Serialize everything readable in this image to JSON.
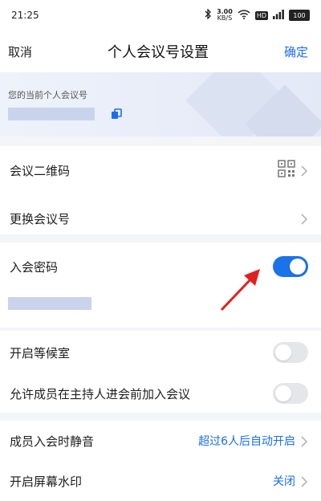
{
  "status_bar": {
    "time": "21:25",
    "speed": "3.00",
    "speed_unit": "KB/S",
    "hd": "HD",
    "battery": "100"
  },
  "nav": {
    "cancel": "取消",
    "title": "个人会议号设置",
    "confirm": "确定"
  },
  "banner": {
    "label": "您的当前个人会议号"
  },
  "rows": {
    "qr": {
      "label": "会议二维码"
    },
    "change_id": {
      "label": "更换会议号"
    },
    "password": {
      "label": "入会密码",
      "enabled": true
    },
    "waiting_room": {
      "label": "开启等候室",
      "enabled": false
    },
    "join_before_host": {
      "label": "允许成员在主持人进会前加入会议",
      "enabled": false
    },
    "mute_on_entry": {
      "label": "成员入会时静音",
      "value": "超过6人后自动开启"
    },
    "watermark": {
      "label": "开启屏幕水印",
      "value": "关闭"
    }
  },
  "colors": {
    "accent": "#1a73e8",
    "link": "#1a6ef2",
    "arrow": "#e02020"
  }
}
